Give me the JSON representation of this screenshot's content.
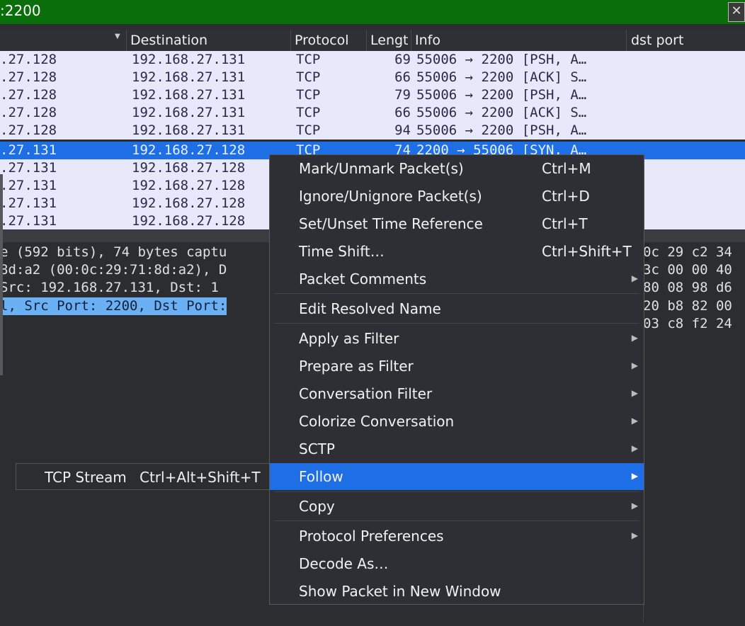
{
  "filter": {
    "text": ":2200",
    "clear_icon": "clear-filter-icon"
  },
  "columns": {
    "destination": "Destination",
    "protocol": "Protocol",
    "length": "Lengt",
    "info": "Info",
    "dst_port": "dst port"
  },
  "packets": [
    {
      "src": ".27.128",
      "dst": "192.168.27.131",
      "proto": "TCP",
      "len": "69",
      "info": "55006 → 2200 [PSH, A…"
    },
    {
      "src": ".27.128",
      "dst": "192.168.27.131",
      "proto": "TCP",
      "len": "66",
      "info": "55006 → 2200 [ACK] S…"
    },
    {
      "src": ".27.128",
      "dst": "192.168.27.131",
      "proto": "TCP",
      "len": "79",
      "info": "55006 → 2200 [PSH, A…"
    },
    {
      "src": ".27.128",
      "dst": "192.168.27.131",
      "proto": "TCP",
      "len": "66",
      "info": "55006 → 2200 [ACK] S…"
    },
    {
      "src": ".27.128",
      "dst": "192.168.27.131",
      "proto": "TCP",
      "len": "94",
      "info": "55006 → 2200 [PSH, A…"
    },
    {
      "src": ".27.131",
      "dst": "192.168.27.128",
      "proto": "TCP",
      "len": "74",
      "info": "2200 → 55006 [SYN, A…"
    },
    {
      "src": ".27.131",
      "dst": "192.168.27.128",
      "proto": "",
      "len": "",
      "info": ""
    },
    {
      "src": ".27.131",
      "dst": "192.168.27.128",
      "proto": "",
      "len": "",
      "info": ""
    },
    {
      "src": ".27.131",
      "dst": "192.168.27.128",
      "proto": "",
      "len": "",
      "info": ""
    },
    {
      "src": ".27.131",
      "dst": "192.168.27.128",
      "proto": "",
      "len": "",
      "info": ""
    }
  ],
  "details": [
    "e (592 bits), 74 bytes captu",
    "8d:a2 (00:0c:29:71:8d:a2), D",
    " Src: 192.168.27.131, Dst: 1",
    "l, Src Port: 2200, Dst Port:"
  ],
  "hex": [
    "0c 29 c2 34",
    "3c 00 00 40",
    "80 08 98 d6",
    "20 b8 82 00",
    "03 c8 f2 24"
  ],
  "submenu": {
    "label": "TCP Stream",
    "shortcut": "Ctrl+Alt+Shift+T"
  },
  "menu": {
    "mark": "Mark/Unmark Packet(s)",
    "mark_sc": "Ctrl+M",
    "ignore": "Ignore/Unignore Packet(s)",
    "ignore_sc": "Ctrl+D",
    "timeref": "Set/Unset Time Reference",
    "timeref_sc": "Ctrl+T",
    "timeshift": "Time Shift…",
    "timeshift_sc": "Ctrl+Shift+T",
    "comments": "Packet Comments",
    "edit_resolved": "Edit Resolved Name",
    "apply_filter": "Apply as Filter",
    "prepare_filter": "Prepare as Filter",
    "conv_filter": "Conversation Filter",
    "colorize": "Colorize Conversation",
    "sctp": "SCTP",
    "follow": "Follow",
    "copy": "Copy",
    "proto_prefs": "Protocol Preferences",
    "decode_as": "Decode As…",
    "show_new_window": "Show Packet in New Window"
  }
}
